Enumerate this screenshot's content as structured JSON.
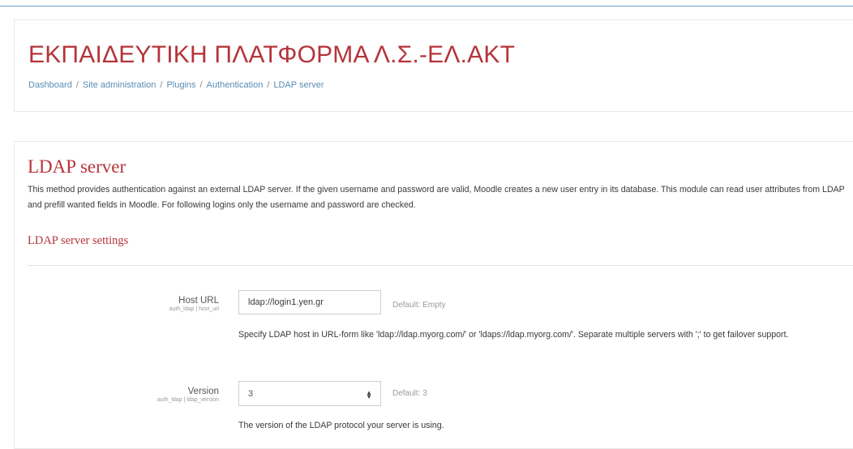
{
  "header": {
    "site_title": "ΕΚΠΑΙΔΕΥΤΙΚΗ ΠΛΑΤΦΟΡΜΑ Λ.Σ.-ΕΛ.ΑΚΤ",
    "breadcrumb": [
      "Dashboard",
      "Site administration",
      "Plugins",
      "Authentication",
      "LDAP server"
    ],
    "breadcrumb_separator": "/"
  },
  "main": {
    "heading": "LDAP server",
    "description": "This method provides authentication against an external LDAP server. If the given username and password are valid, Moodle creates a new user entry in its database. This module can read user attributes from LDAP and prefill wanted fields in Moodle. For following logins only the username and password are checked.",
    "section_heading": "LDAP server settings"
  },
  "settings": {
    "host_url": {
      "label": "Host URL",
      "key": "auth_ldap | host_url",
      "value": "ldap://login1.yen.gr",
      "default": "Default: Empty",
      "help": "Specify LDAP host in URL-form like 'ldap://ldap.myorg.com/' or 'ldaps://ldap.myorg.com/'. Separate multiple servers with ';' to get failover support."
    },
    "version": {
      "label": "Version",
      "key": "auth_ldap | ldap_version",
      "value": "3",
      "default": "Default: 3",
      "help": "The version of the LDAP protocol your server is using."
    }
  },
  "colors": {
    "brand_red": "#b5343a",
    "link_blue": "#5a8db4"
  }
}
